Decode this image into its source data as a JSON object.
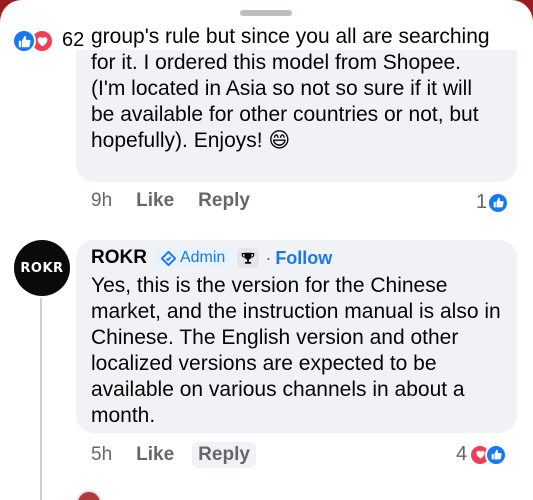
{
  "reactions_summary": {
    "count": "62"
  },
  "comment1": {
    "partial_line": "group's rule but since you all are searching",
    "body": "for it. I ordered this model from Shopee. (I'm located in Asia so not so sure if  it will be available for other countries or not, but hopefully). Enjoys! 😄",
    "time": "9h",
    "like_label": "Like",
    "reply_label": "Reply",
    "reaction_count": "1"
  },
  "comment2": {
    "avatar_text": "ROKR",
    "author": "ROKR",
    "badge_label": "Admin",
    "follow_separator": "·",
    "follow_label": "Follow",
    "body": "Yes, this is the version for the Chinese market, and the instruction manual is also in Chinese. The English version and other localized versions are expected to be available on various channels in about a month.",
    "time": "5h",
    "like_label": "Like",
    "reply_label": "Reply",
    "reaction_count": "4"
  },
  "colors": {
    "background_top": "#9b1c1c",
    "like_blue": "#1877f2",
    "love_red": "#f33e58",
    "bubble_grey": "#f0f2f5"
  }
}
